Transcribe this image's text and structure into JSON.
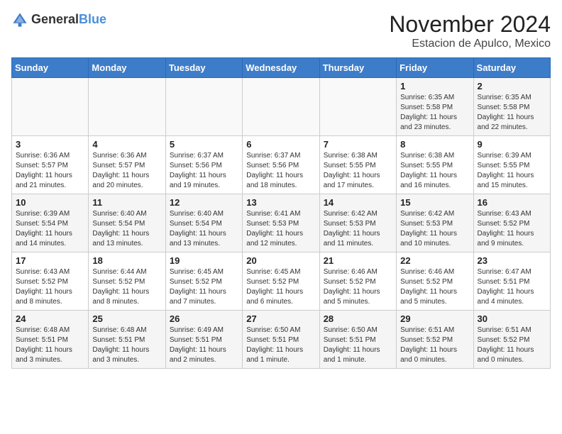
{
  "logo": {
    "general": "General",
    "blue": "Blue"
  },
  "title": "November 2024",
  "subtitle": "Estacion de Apulco, Mexico",
  "weekdays": [
    "Sunday",
    "Monday",
    "Tuesday",
    "Wednesday",
    "Thursday",
    "Friday",
    "Saturday"
  ],
  "weeks": [
    [
      {
        "day": "",
        "info": ""
      },
      {
        "day": "",
        "info": ""
      },
      {
        "day": "",
        "info": ""
      },
      {
        "day": "",
        "info": ""
      },
      {
        "day": "",
        "info": ""
      },
      {
        "day": "1",
        "info": "Sunrise: 6:35 AM\nSunset: 5:58 PM\nDaylight: 11 hours and 23 minutes."
      },
      {
        "day": "2",
        "info": "Sunrise: 6:35 AM\nSunset: 5:58 PM\nDaylight: 11 hours and 22 minutes."
      }
    ],
    [
      {
        "day": "3",
        "info": "Sunrise: 6:36 AM\nSunset: 5:57 PM\nDaylight: 11 hours and 21 minutes."
      },
      {
        "day": "4",
        "info": "Sunrise: 6:36 AM\nSunset: 5:57 PM\nDaylight: 11 hours and 20 minutes."
      },
      {
        "day": "5",
        "info": "Sunrise: 6:37 AM\nSunset: 5:56 PM\nDaylight: 11 hours and 19 minutes."
      },
      {
        "day": "6",
        "info": "Sunrise: 6:37 AM\nSunset: 5:56 PM\nDaylight: 11 hours and 18 minutes."
      },
      {
        "day": "7",
        "info": "Sunrise: 6:38 AM\nSunset: 5:55 PM\nDaylight: 11 hours and 17 minutes."
      },
      {
        "day": "8",
        "info": "Sunrise: 6:38 AM\nSunset: 5:55 PM\nDaylight: 11 hours and 16 minutes."
      },
      {
        "day": "9",
        "info": "Sunrise: 6:39 AM\nSunset: 5:55 PM\nDaylight: 11 hours and 15 minutes."
      }
    ],
    [
      {
        "day": "10",
        "info": "Sunrise: 6:39 AM\nSunset: 5:54 PM\nDaylight: 11 hours and 14 minutes."
      },
      {
        "day": "11",
        "info": "Sunrise: 6:40 AM\nSunset: 5:54 PM\nDaylight: 11 hours and 13 minutes."
      },
      {
        "day": "12",
        "info": "Sunrise: 6:40 AM\nSunset: 5:54 PM\nDaylight: 11 hours and 13 minutes."
      },
      {
        "day": "13",
        "info": "Sunrise: 6:41 AM\nSunset: 5:53 PM\nDaylight: 11 hours and 12 minutes."
      },
      {
        "day": "14",
        "info": "Sunrise: 6:42 AM\nSunset: 5:53 PM\nDaylight: 11 hours and 11 minutes."
      },
      {
        "day": "15",
        "info": "Sunrise: 6:42 AM\nSunset: 5:53 PM\nDaylight: 11 hours and 10 minutes."
      },
      {
        "day": "16",
        "info": "Sunrise: 6:43 AM\nSunset: 5:52 PM\nDaylight: 11 hours and 9 minutes."
      }
    ],
    [
      {
        "day": "17",
        "info": "Sunrise: 6:43 AM\nSunset: 5:52 PM\nDaylight: 11 hours and 8 minutes."
      },
      {
        "day": "18",
        "info": "Sunrise: 6:44 AM\nSunset: 5:52 PM\nDaylight: 11 hours and 8 minutes."
      },
      {
        "day": "19",
        "info": "Sunrise: 6:45 AM\nSunset: 5:52 PM\nDaylight: 11 hours and 7 minutes."
      },
      {
        "day": "20",
        "info": "Sunrise: 6:45 AM\nSunset: 5:52 PM\nDaylight: 11 hours and 6 minutes."
      },
      {
        "day": "21",
        "info": "Sunrise: 6:46 AM\nSunset: 5:52 PM\nDaylight: 11 hours and 5 minutes."
      },
      {
        "day": "22",
        "info": "Sunrise: 6:46 AM\nSunset: 5:52 PM\nDaylight: 11 hours and 5 minutes."
      },
      {
        "day": "23",
        "info": "Sunrise: 6:47 AM\nSunset: 5:51 PM\nDaylight: 11 hours and 4 minutes."
      }
    ],
    [
      {
        "day": "24",
        "info": "Sunrise: 6:48 AM\nSunset: 5:51 PM\nDaylight: 11 hours and 3 minutes."
      },
      {
        "day": "25",
        "info": "Sunrise: 6:48 AM\nSunset: 5:51 PM\nDaylight: 11 hours and 3 minutes."
      },
      {
        "day": "26",
        "info": "Sunrise: 6:49 AM\nSunset: 5:51 PM\nDaylight: 11 hours and 2 minutes."
      },
      {
        "day": "27",
        "info": "Sunrise: 6:50 AM\nSunset: 5:51 PM\nDaylight: 11 hours and 1 minute."
      },
      {
        "day": "28",
        "info": "Sunrise: 6:50 AM\nSunset: 5:51 PM\nDaylight: 11 hours and 1 minute."
      },
      {
        "day": "29",
        "info": "Sunrise: 6:51 AM\nSunset: 5:52 PM\nDaylight: 11 hours and 0 minutes."
      },
      {
        "day": "30",
        "info": "Sunrise: 6:51 AM\nSunset: 5:52 PM\nDaylight: 11 hours and 0 minutes."
      }
    ]
  ]
}
